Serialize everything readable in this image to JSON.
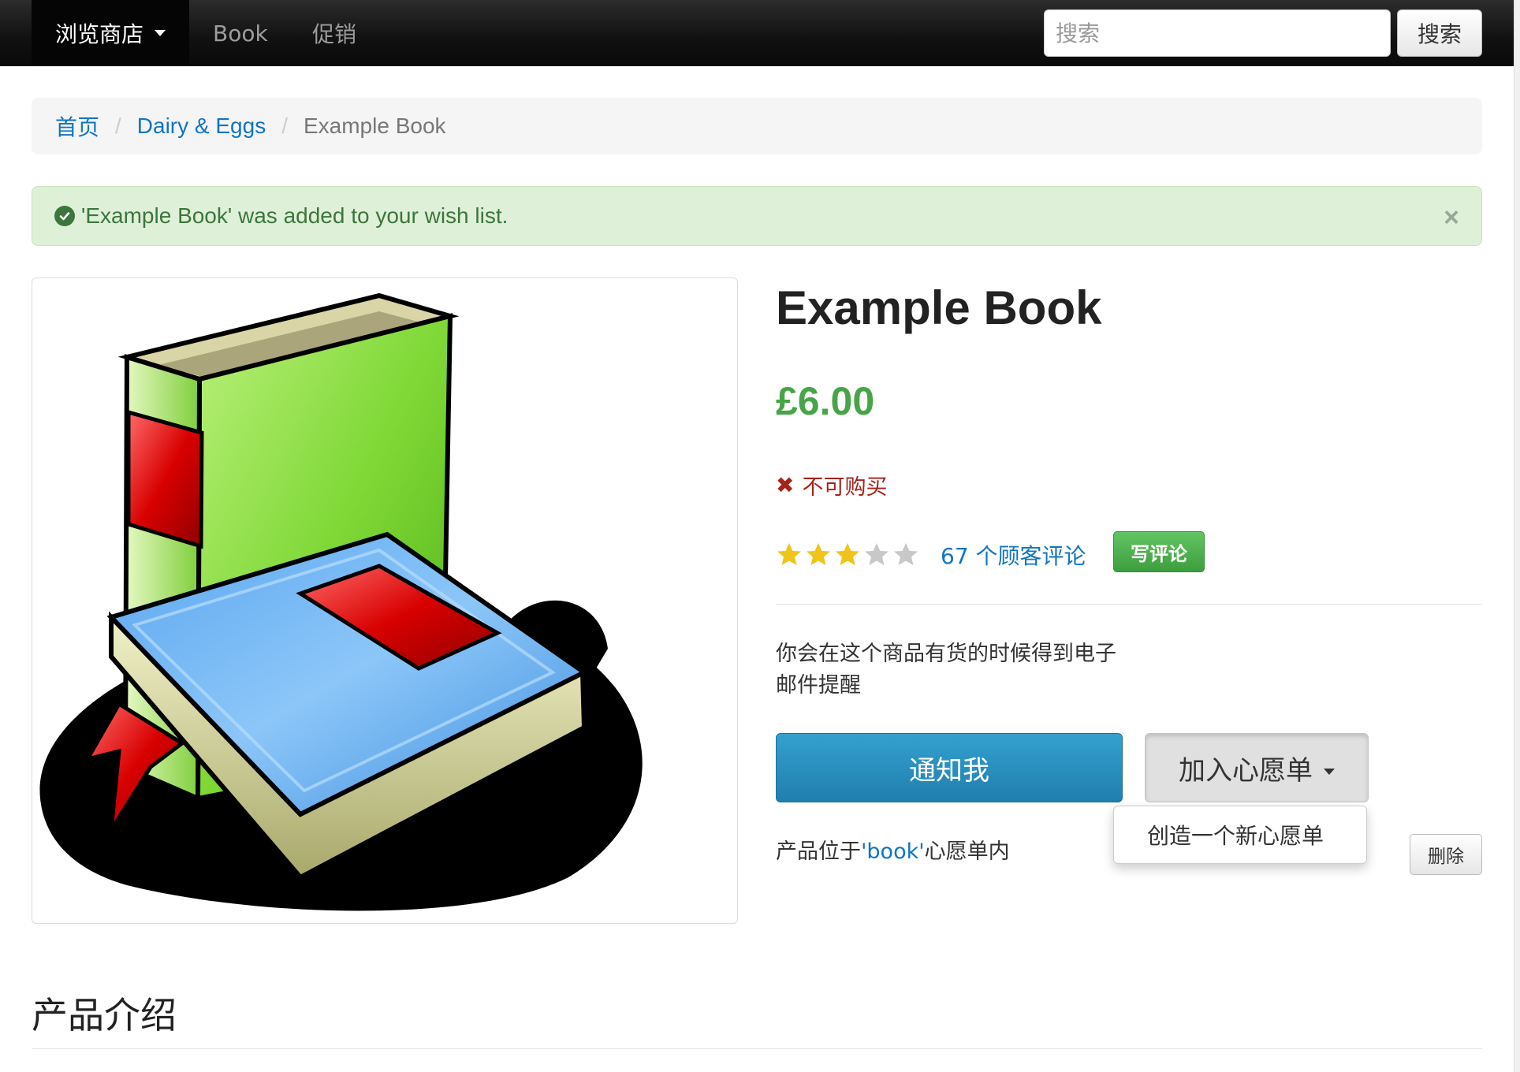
{
  "navbar": {
    "browse_label": "浏览商店",
    "links": [
      "Book",
      "促销"
    ],
    "search_placeholder": "搜索",
    "search_button": "搜索"
  },
  "breadcrumb": {
    "items": [
      "首页",
      "Dairy & Eggs"
    ],
    "separator": "/",
    "active": "Example Book"
  },
  "alert": {
    "message": "'Example Book' was added to your wish list.",
    "close": "×"
  },
  "product": {
    "title": "Example Book",
    "price": "£6.00",
    "availability": "不可购买",
    "rating": {
      "value": 3,
      "max": 5
    },
    "reviews_link": "67 个顾客评论",
    "write_review": "写评论",
    "notify_text": "你会在这个商品有货的时候得到电子邮件提醒",
    "notify_button": "通知我",
    "wishlist_button": "加入心愿单",
    "dropdown_item": "创造一个新心愿单",
    "in_wishlist_prefix": "产品位于",
    "in_wishlist_name": "'book'",
    "in_wishlist_suffix": "心愿单内",
    "delete_button": "删除"
  },
  "description": {
    "heading": "产品介绍"
  },
  "colors": {
    "navbar": "#111111",
    "link": "#0f75c4",
    "price": "#47a447",
    "unavailable": "#a5221b",
    "alert_bg": "#dff0d8",
    "alert_text": "#3c763d",
    "notify": "#2a8fc1",
    "write_review": "#4cae4c",
    "star_on": "#f0c419",
    "star_off": "#c8c8c8"
  },
  "icons": {
    "alert": "check-circle-icon",
    "availability": "x-mark-icon",
    "caret": "caret-down-icon",
    "star": "star-icon"
  }
}
